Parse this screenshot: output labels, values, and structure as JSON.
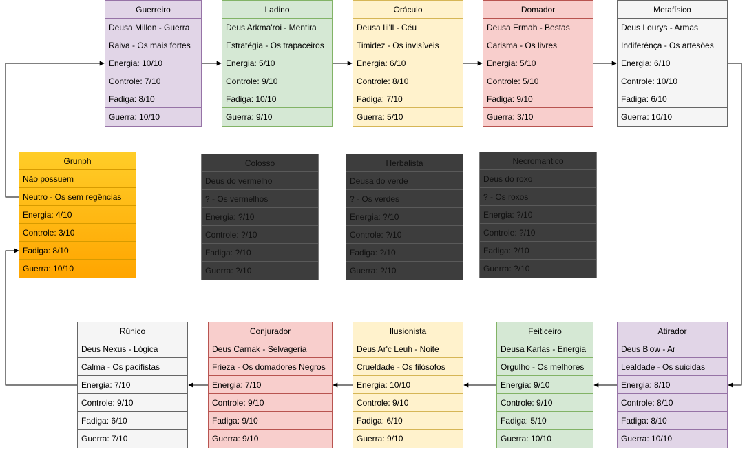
{
  "cards": {
    "guerreiro": {
      "title": "Guerreiro",
      "rows": [
        "Deusa Millon - Guerra",
        "Raiva - Os mais fortes",
        "Energia: 10/10",
        "Controle: 7/10",
        "Fadiga: 8/10",
        "Guerra: 10/10"
      ]
    },
    "ladino": {
      "title": "Ladino",
      "rows": [
        "Deus Arkma'roi - Mentira",
        "Estratégia - Os trapaceiros",
        "Energia: 5/10",
        "Controle: 9/10",
        "Fadiga: 10/10",
        "Guerra: 9/10"
      ]
    },
    "oraculo": {
      "title": "Oráculo",
      "rows": [
        "Deusa Iii'll - Céu",
        "Timidez - Os invisíveis",
        "Energia: 6/10",
        "Controle: 8/10",
        "Fadiga: 7/10",
        "Guerra: 5/10"
      ]
    },
    "domador": {
      "title": "Domador",
      "rows": [
        "Deusa Ermah - Bestas",
        "Carisma - Os livres",
        "Energia: 5/10",
        "Controle: 5/10",
        "Fadiga: 9/10",
        "Guerra: 3/10"
      ]
    },
    "metafisico": {
      "title": "Metafísico",
      "rows": [
        "Deus Lourys - Armas",
        "Indiferênça - Os artesões",
        "Energia: 6/10",
        "Controle: 10/10",
        "Fadiga: 6/10",
        "Guerra: 10/10"
      ]
    },
    "grunph": {
      "title": "Grunph",
      "rows": [
        "Não possuem",
        "Neutro - Os sem regências",
        "Energia: 4/10",
        "Controle: 3/10",
        "Fadiga: 8/10",
        "Guerra: 10/10"
      ]
    },
    "colosso": {
      "title": "Colosso",
      "rows": [
        "Deus do vermelho",
        "? - Os vermelhos",
        "Energia: ?/10",
        "Controle: ?/10",
        "Fadiga: ?/10",
        "Guerra: ?/10"
      ]
    },
    "herbalista": {
      "title": "Herbalista",
      "rows": [
        "Deusa do verde",
        "? - Os verdes",
        "Energia: ?/10",
        "Controle: ?/10",
        "Fadiga: ?/10",
        "Guerra: ?/10"
      ]
    },
    "necromantico": {
      "title": "Necromantico",
      "rows": [
        "Deus do roxo",
        "? - Os roxos",
        "Energia: ?/10",
        "Controle: ?/10",
        "Fadiga: ?/10",
        "Guerra: ?/10"
      ]
    },
    "runico": {
      "title": "Rúnico",
      "rows": [
        "Deus Nexus - Lógica",
        "Calma - Os pacifistas",
        "Energia: 7/10",
        "Controle: 9/10",
        "Fadiga: 6/10",
        "Guerra: 7/10"
      ]
    },
    "conjurador": {
      "title": "Conjurador",
      "rows": [
        "Deus Carnak - Selvageria",
        "Frieza - Os domadores Negros",
        "Energia: 7/10",
        "Controle: 9/10",
        "Fadiga: 9/10",
        "Guerra: 9/10"
      ]
    },
    "ilusionista": {
      "title": "Ilusionista",
      "rows": [
        "Deus Ar'c Leuh - Noite",
        "Crueldade - Os filósofos",
        "Energia: 10/10",
        "Controle: 9/10",
        "Fadiga: 6/10",
        "Guerra: 9/10"
      ]
    },
    "feiticeiro": {
      "title": "Feiticeiro",
      "rows": [
        "Deusa Karlas - Energia",
        "Orgulho - Os melhores",
        "Energia: 9/10",
        "Controle: 9/10",
        "Fadiga: 5/10",
        "Guerra: 10/10"
      ]
    },
    "atirador": {
      "title": "Atirador",
      "rows": [
        "Deus B'ow - Ar",
        "Lealdade - Os suicidas",
        "Energia: 8/10",
        "Controle: 8/10",
        "Fadiga: 8/10",
        "Guerra: 10/10"
      ]
    }
  },
  "colors": {
    "purple": "#e1d5e7",
    "green": "#d5e8d4",
    "yellow": "#fff2cc",
    "red": "#f8cecc",
    "gray": "#f5f5f5",
    "orange": "#ffa500",
    "dark": "#3d3d3d",
    "connector": "#000000"
  }
}
